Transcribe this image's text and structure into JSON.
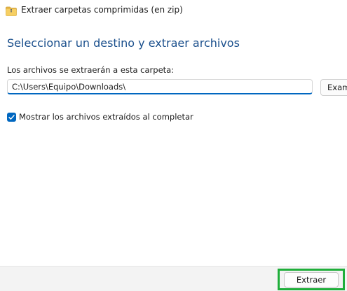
{
  "window": {
    "title": "Extraer carpetas comprimidas (en zip)",
    "title_icon": "zip-folder-icon"
  },
  "main": {
    "heading": "Seleccionar un destino y extraer archivos",
    "destination_label": "Los archivos se extraerán a esta carpeta:",
    "destination_path": "C:\\Users\\Equipo\\Downloads\\",
    "browse_label": "Examinar...",
    "show_files_checkbox": {
      "label": "Mostrar los archivos extraídos al completar",
      "checked": true
    }
  },
  "footer": {
    "extract_label": "Extraer"
  },
  "colors": {
    "heading": "#1a4f8c",
    "accent": "#0067c0",
    "highlight": "#1fae3a",
    "footer_bg": "#f3f3f3"
  }
}
